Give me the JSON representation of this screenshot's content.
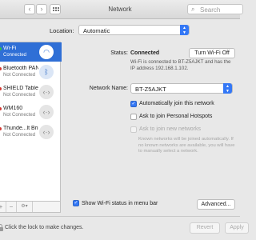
{
  "window": {
    "title": "Network"
  },
  "toolbar": {
    "back": "‹",
    "forward": "›",
    "search_placeholder": "Search"
  },
  "location": {
    "label": "Location:",
    "value": "Automatic"
  },
  "sidebar": {
    "items": [
      {
        "name": "Wi-Fi",
        "status": "Connected",
        "dot": "#2fbe4b",
        "icon": "wifi-icon",
        "glyph": "◠",
        "selected": true
      },
      {
        "name": "Bluetooth PAN",
        "status": "Not Connected",
        "dot": "#d33b35",
        "icon": "bluetooth-icon",
        "glyph": "ᛒ"
      },
      {
        "name": "SHIELD Tablet",
        "status": "Not Connected",
        "dot": "#d33b35",
        "icon": "ethernet-arrows-icon",
        "glyph": "‹·›"
      },
      {
        "name": "WM160",
        "status": "Not Connected",
        "dot": "#d33b35",
        "icon": "ethernet-arrows-icon",
        "glyph": "‹·›"
      },
      {
        "name": "Thunde...lt Bridge",
        "status": "Not Connected",
        "dot": "#d33b35",
        "icon": "ethernet-arrows-icon",
        "glyph": "‹·›"
      }
    ],
    "add": "+",
    "remove": "−",
    "action": "⚙▾"
  },
  "detail": {
    "status_label": "Status:",
    "status_value": "Connected",
    "turn_off": "Turn Wi-Fi Off",
    "status_desc": "Wi-Fi is connected to BT-Z5AJKT and has the IP address 192.168.1.102.",
    "network_name_label": "Network Name:",
    "network_name": "BT-Z5AJKT",
    "auto_join": "Automatically join this network",
    "ask_hotspots": "Ask to join Personal Hotspots",
    "ask_new": "Ask to join new networks",
    "ask_new_desc": "Known networks will be joined automatically. If no known networks are available, you will have to manually select a network.",
    "show_status": "Show Wi-Fi status in menu bar",
    "advanced": "Advanced...",
    "help": "?"
  },
  "footer": {
    "lock_text": "Click the lock to make changes.",
    "revert": "Revert",
    "apply": "Apply"
  },
  "colors": {
    "accent": "#3478f6",
    "selected_row": "#2f6fd6",
    "connected": "#2fbe4b",
    "not_connected": "#d33b35"
  }
}
